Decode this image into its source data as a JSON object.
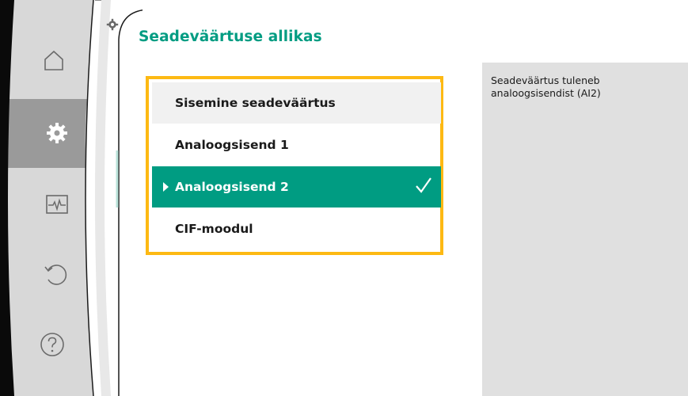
{
  "header": {
    "title": "Seadeväärtuse allikas"
  },
  "sidebar": {
    "items": [
      {
        "icon": "home-icon",
        "active": false
      },
      {
        "icon": "gear-icon",
        "active": true
      },
      {
        "icon": "diagnostics-icon",
        "active": false
      },
      {
        "icon": "restore-icon",
        "active": false
      },
      {
        "icon": "help-icon",
        "active": false
      }
    ]
  },
  "menu": {
    "items": [
      {
        "label": "Sisemine seadeväärtus",
        "state": "highlighted"
      },
      {
        "label": "Analoogsisend 1",
        "state": "normal"
      },
      {
        "label": "Analoogsisend 2",
        "state": "selected"
      },
      {
        "label": "CIF-moodul",
        "state": "normal"
      }
    ]
  },
  "info": {
    "text": "Seadeväärtus tuleneb analoogsisendist (AI2)"
  },
  "colors": {
    "accent": "#009c82",
    "focus_border": "#fdb913",
    "sidebar_gray": "#d8d8d8",
    "sidebar_active": "#9a9a9a",
    "panel": "#e0e0e0"
  }
}
